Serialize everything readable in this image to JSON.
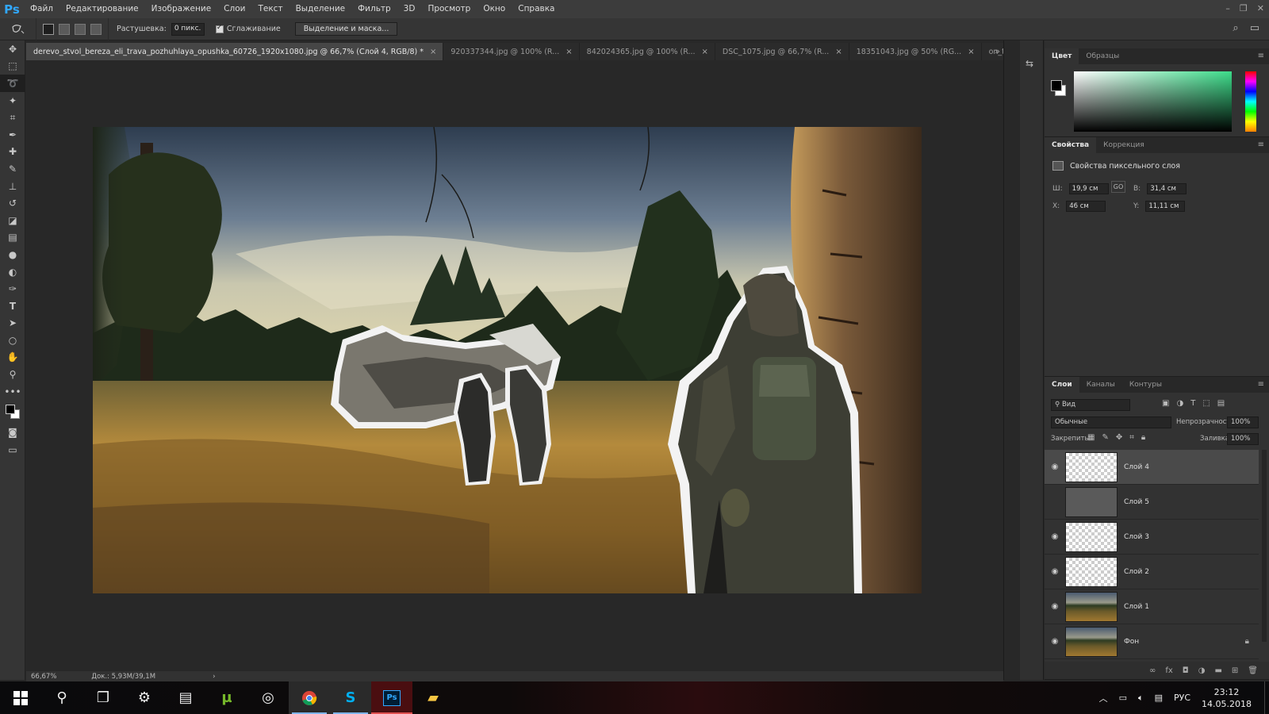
{
  "app": {
    "logo": "Ps"
  },
  "menu": [
    "Файл",
    "Редактирование",
    "Изображение",
    "Слои",
    "Текст",
    "Выделение",
    "Фильтр",
    "3D",
    "Просмотр",
    "Окно",
    "Справка"
  ],
  "options": {
    "feather_label": "Растушевка:",
    "feather_value": "0 пикс.",
    "antialias_label": "Сглаживание",
    "select_mask_button": "Выделение и маска..."
  },
  "tabs": [
    {
      "label": "derevo_stvol_bereza_eli_trava_pozhuhlaya_opushka_60726_1920x1080.jpg @ 66,7% (Слой 4, RGB/8) *",
      "active": true
    },
    {
      "label": "920337344.jpg @ 100% (R...",
      "active": false
    },
    {
      "label": "842024365.jpg @ 100% (R...",
      "active": false
    },
    {
      "label": "DSC_1075.jpg @ 66,7% (R...",
      "active": false
    },
    {
      "label": "18351043.jpg @ 50% (RG...",
      "active": false
    },
    {
      "label": "on_the_road__s_t_a_l_k_e_r__cosp",
      "active": false
    }
  ],
  "status": {
    "zoom": "66,67%",
    "doc": "Док.: 5,93M/39,1M"
  },
  "color_panel": {
    "tabs": [
      "Цвет",
      "Образцы"
    ],
    "active": "Цвет",
    "colors": {
      "hue_selected": "#3ddc8a"
    }
  },
  "properties_panel": {
    "tabs": [
      "Свойства",
      "Коррекция"
    ],
    "title": "Свойства пиксельного слоя",
    "w_label": "Ш:",
    "w_value": "19,9 см",
    "h_label": "В:",
    "h_value": "31,4 см",
    "x_label": "X:",
    "x_value": "46 см",
    "y_label": "Y:",
    "y_value": "11,11 см",
    "link_label": "GO"
  },
  "layers_panel": {
    "tabs": [
      "Слои",
      "Каналы",
      "Контуры"
    ],
    "filter_value": "Вид",
    "blend_mode": "Обычные",
    "opacity_label": "Непрозрачность:",
    "opacity_value": "100%",
    "lock_label": "Закрепить:",
    "fill_label": "Заливка:",
    "fill_value": "100%",
    "layers": [
      {
        "name": "Слой 4",
        "visible": true,
        "selected": true,
        "thumb": "transparent"
      },
      {
        "name": "Слой 5",
        "visible": false,
        "selected": false,
        "thumb": "dark"
      },
      {
        "name": "Слой 3",
        "visible": true,
        "selected": false,
        "thumb": "transparent"
      },
      {
        "name": "Слой 2",
        "visible": true,
        "selected": false,
        "thumb": "transparent"
      },
      {
        "name": "Слой 1",
        "visible": true,
        "selected": false,
        "thumb": "photo"
      },
      {
        "name": "Фон",
        "visible": true,
        "selected": false,
        "thumb": "photo",
        "locked": true
      }
    ]
  },
  "taskbar": {
    "icons": [
      "windows-start",
      "search",
      "task-view",
      "settings",
      "file-manager",
      "utorrent",
      "steam",
      "chrome",
      "skype",
      "photoshop",
      "explorer"
    ],
    "lang": "РУС",
    "time": "23:12",
    "date": "14.05.2018",
    "ps_label": "Ps"
  }
}
